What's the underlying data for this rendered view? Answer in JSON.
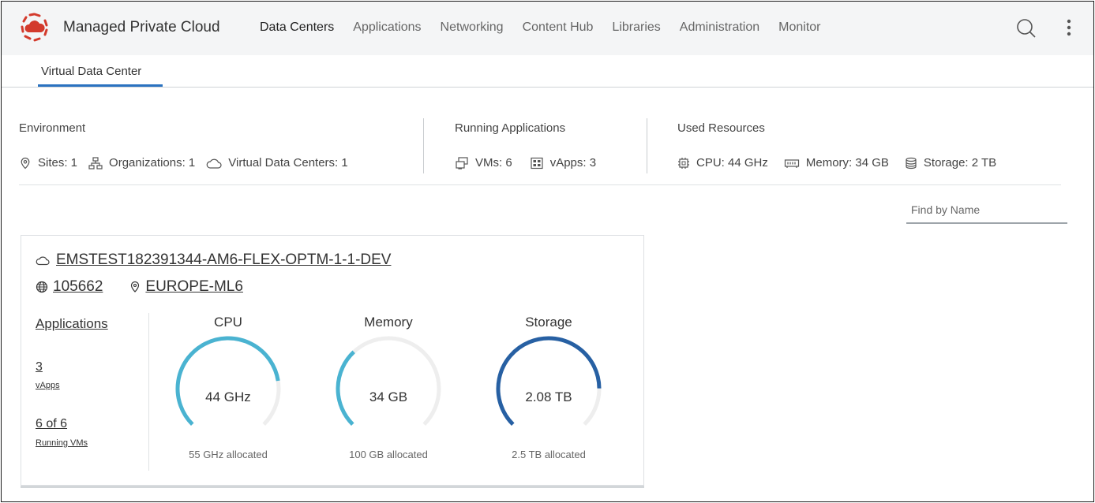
{
  "header": {
    "app_title": "Managed Private Cloud",
    "nav": [
      {
        "label": "Data Centers",
        "active": true
      },
      {
        "label": "Applications",
        "active": false
      },
      {
        "label": "Networking",
        "active": false
      },
      {
        "label": "Content Hub",
        "active": false
      },
      {
        "label": "Libraries",
        "active": false
      },
      {
        "label": "Administration",
        "active": false
      },
      {
        "label": "Monitor",
        "active": false
      }
    ]
  },
  "subnav": {
    "tab": "Virtual Data Center"
  },
  "summary": {
    "environment": {
      "title": "Environment",
      "sites": "Sites:  1",
      "organizations": "Organizations:  1",
      "vdcs": "Virtual Data Centers:  1"
    },
    "running": {
      "title": "Running Applications",
      "vms": "VMs:  6",
      "vapps": "vApps:  3"
    },
    "used": {
      "title": "Used Resources",
      "cpu": "CPU:  44 GHz",
      "memory": "Memory:  34 GB",
      "storage": "Storage:  2 TB"
    }
  },
  "filter": {
    "placeholder": "Find by Name"
  },
  "card": {
    "name": "EMSTEST182391344-AM6-FLEX-OPTM-1-1-DEV",
    "org_id": "105662",
    "site": "EUROPE-ML6",
    "applications": {
      "link": "Applications",
      "vapps_count": "3",
      "vapps_label": "vApps",
      "vms_count": "6 of 6",
      "vms_label": "Running VMs"
    },
    "gauges": [
      {
        "label": "CPU",
        "value": "44 GHz",
        "allocated": "55 GHz allocated",
        "fraction": 0.8,
        "color": "#4ab3d1"
      },
      {
        "label": "Memory",
        "value": "34 GB",
        "allocated": "100 GB allocated",
        "fraction": 0.34,
        "color": "#4ab3d1"
      },
      {
        "label": "Storage",
        "value": "2.08 TB",
        "allocated": "2.5 TB allocated",
        "fraction": 0.832,
        "color": "#2760a3"
      }
    ]
  }
}
